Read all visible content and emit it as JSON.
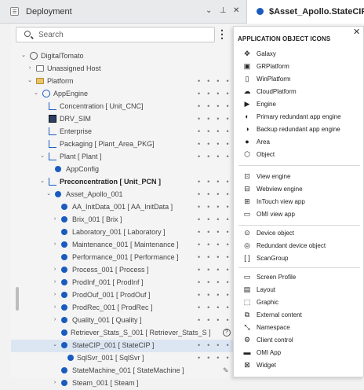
{
  "topbar": {
    "left_title": "Deployment",
    "right_tab_label": "$Asset_Apollo.StateCIP",
    "btn_chevron": "⌄",
    "btn_pin": "⊥",
    "btn_close": "✕"
  },
  "search": {
    "placeholder": "Search"
  },
  "tree": [
    {
      "label": "DigitalTomato",
      "bold": false
    },
    {
      "label": "Unassigned Host",
      "bold": false
    },
    {
      "label": "Platform",
      "bold": false
    },
    {
      "label": "AppEngine",
      "bold": false
    },
    {
      "label": "Concentration [ Unit_CNC]",
      "bold": false
    },
    {
      "label": "DRV_SIM",
      "bold": false
    },
    {
      "label": "Enterprise",
      "bold": false
    },
    {
      "label": "Packaging [ Plant_Area_PKG]",
      "bold": false
    },
    {
      "label": "Plant [ Plant ]",
      "bold": false
    },
    {
      "label": "AppConfig",
      "bold": false
    },
    {
      "label": "Preconcentration [ Unit_PCN ]",
      "bold": true
    },
    {
      "label": "Asset_Apollo_001",
      "bold": false
    },
    {
      "label": "AA_InitData_001 [ AA_InitData ]",
      "bold": false
    },
    {
      "label": "Brix_001 [ Brix ]",
      "bold": false
    },
    {
      "label": "Laboratory_001 [ Laboratory ]",
      "bold": false
    },
    {
      "label": "Maintenance_001 [ Maintenance ]",
      "bold": false
    },
    {
      "label": "Performance_001 [ Performance ]",
      "bold": false
    },
    {
      "label": "Process_001 [ Process ]",
      "bold": false
    },
    {
      "label": "ProdInf_001 [ ProdInf ]",
      "bold": false
    },
    {
      "label": "ProdOuf_001 [ ProdOuf ]",
      "bold": false
    },
    {
      "label": "ProdRec_001 [ ProdRec ]",
      "bold": false
    },
    {
      "label": "Quality_001 [ Quality ]",
      "bold": false
    },
    {
      "label": "Retriever_Stats_S_001 [ Retriever_Stats_S ]",
      "bold": false
    },
    {
      "label": "StateCIP_001 [ StateCIP ]",
      "bold": false
    },
    {
      "label": "SqlSvr_001 [ SqlSvr ]",
      "bold": false
    },
    {
      "label": "StateMachine_001 [ StateMachine ]",
      "bold": false
    },
    {
      "label": "Steam_001 [ Steam ]",
      "bold": false
    }
  ],
  "popup": {
    "title": "APPLICATION OBJECT ICONS",
    "close": "✕",
    "items": [
      {
        "icon": "galaxy-icon",
        "glyph": "✥",
        "label": "Galaxy"
      },
      {
        "icon": "grplatform-icon",
        "glyph": "▣",
        "label": "GRPlatform"
      },
      {
        "icon": "winplatform-icon",
        "glyph": "▯",
        "label": "WinPlatform"
      },
      {
        "icon": "cloudplatform-icon",
        "glyph": "☁",
        "label": "CloudPlatform"
      },
      {
        "icon": "engine-icon",
        "glyph": "▶",
        "label": "Engine"
      },
      {
        "icon": "primary-redundant-engine-icon",
        "glyph": "◐",
        "label": "Primary redundant app engine"
      },
      {
        "icon": "backup-redundant-engine-icon",
        "glyph": "◑",
        "label": "Backup redundant app engine"
      },
      {
        "icon": "area-icon",
        "glyph": "●",
        "label": "Area"
      },
      {
        "icon": "object-icon",
        "glyph": "⬡",
        "label": "Object"
      },
      {
        "icon": "view-engine-icon",
        "glyph": "⊡",
        "label": "View engine"
      },
      {
        "icon": "webview-engine-icon",
        "glyph": "⊟",
        "label": "Webview engine"
      },
      {
        "icon": "intouch-view-app-icon",
        "glyph": "⊞",
        "label": "InTouch view app"
      },
      {
        "icon": "omi-view-app-icon",
        "glyph": "▭",
        "label": "OMI view app"
      },
      {
        "icon": "device-object-icon",
        "glyph": "⊙",
        "label": "Device object"
      },
      {
        "icon": "redundant-device-object-icon",
        "glyph": "◎",
        "label": "Redundant device object"
      },
      {
        "icon": "scangroup-icon",
        "glyph": "[ ]",
        "label": "ScanGroup"
      },
      {
        "icon": "screen-profile-icon",
        "glyph": "▭",
        "label": "Screen Profile"
      },
      {
        "icon": "layout-icon",
        "glyph": "▤",
        "label": "Layout"
      },
      {
        "icon": "graphic-icon",
        "glyph": "⬚",
        "label": "Graphic"
      },
      {
        "icon": "external-content-icon",
        "glyph": "⧉",
        "label": "External content"
      },
      {
        "icon": "namespace-icon",
        "glyph": "⤡",
        "label": "Namespace"
      },
      {
        "icon": "client-control-icon",
        "glyph": "⚙",
        "label": "Client control"
      },
      {
        "icon": "omi-app-icon",
        "glyph": "▬",
        "label": "OMI App"
      },
      {
        "icon": "widget-icon",
        "glyph": "⊠",
        "label": "Widget"
      }
    ]
  },
  "colors": {
    "accent": "#1a5bbf",
    "selected_row": "#dce6f3"
  }
}
